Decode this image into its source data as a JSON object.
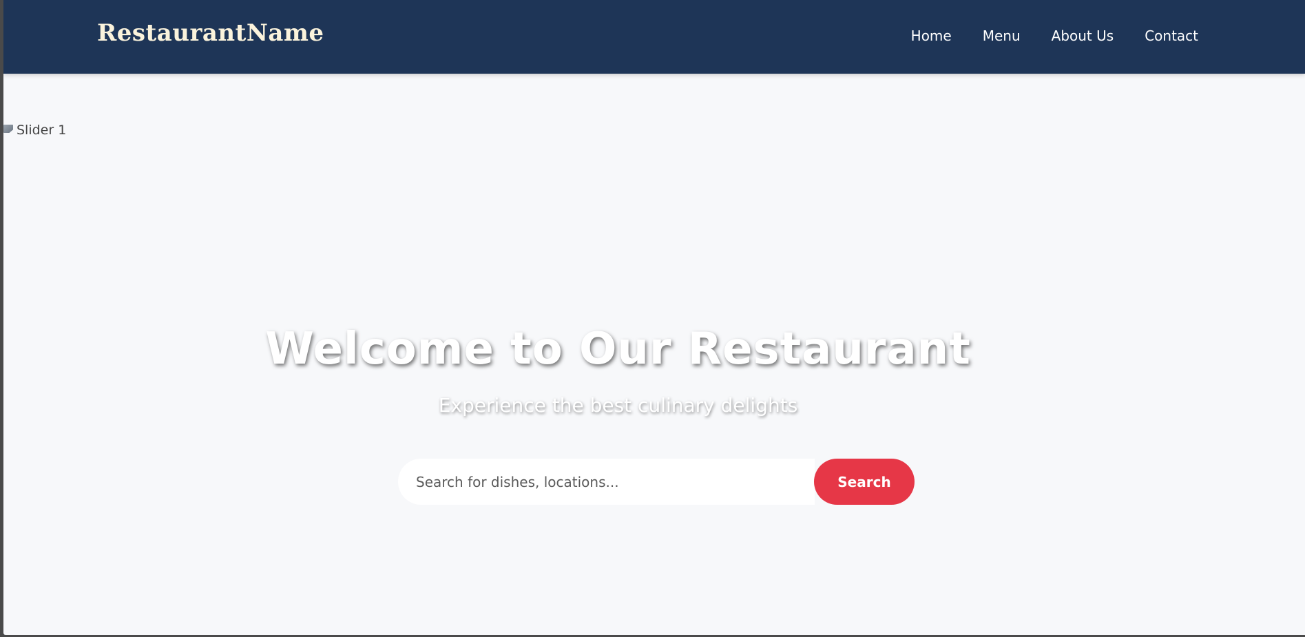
{
  "header": {
    "brand": "RestaurantName",
    "nav": {
      "home": "Home",
      "menu": "Menu",
      "about": "About Us",
      "contact": "Contact"
    }
  },
  "slider": {
    "image_alt": "Slider 1"
  },
  "hero": {
    "title": "Welcome to Our Restaurant",
    "subtitle": "Experience the best culinary delights"
  },
  "search": {
    "placeholder": "Search for dishes, locations...",
    "button_label": "Search"
  },
  "colors": {
    "navbar": "#1e3557",
    "brand_text": "#fbf3dc",
    "page_background": "#f7f8fa",
    "search_button": "#e63747"
  }
}
